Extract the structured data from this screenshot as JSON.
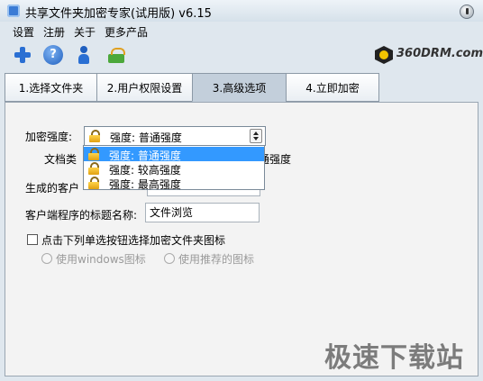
{
  "window": {
    "title": "共享文件夹加密专家(试用版) v6.15"
  },
  "menu": [
    "设置",
    "注册",
    "关于",
    "更多产品"
  ],
  "toolbar": {
    "icons": [
      "plus-icon",
      "help-icon",
      "user-icon",
      "basket-icon"
    ]
  },
  "brand": {
    "text": "360DRM.com"
  },
  "tabs": [
    "1.选择文件夹",
    "2.用户权限设置",
    "3.高级选项",
    "4.立即加密"
  ],
  "active_tab": 2,
  "form": {
    "strength_label": "加密强度:",
    "strength_value": "强度: 普通强度",
    "strength_options": [
      "强度: 普通强度",
      "强度: 较高强度",
      "强度: 最高强度"
    ],
    "doc_type_label": "文档类",
    "doc_type_suffix": "通强度",
    "client_name_label": "生成的客户",
    "client_title_label": "客户端程序的标题名称:",
    "client_title_value": "文件浏览",
    "icon_checkbox_label": "点击下列单选按钮选择加密文件夹图标",
    "radio_windows": "使用windows图标",
    "radio_recommended": "使用推荐的图标"
  },
  "watermark": "极速下载站"
}
